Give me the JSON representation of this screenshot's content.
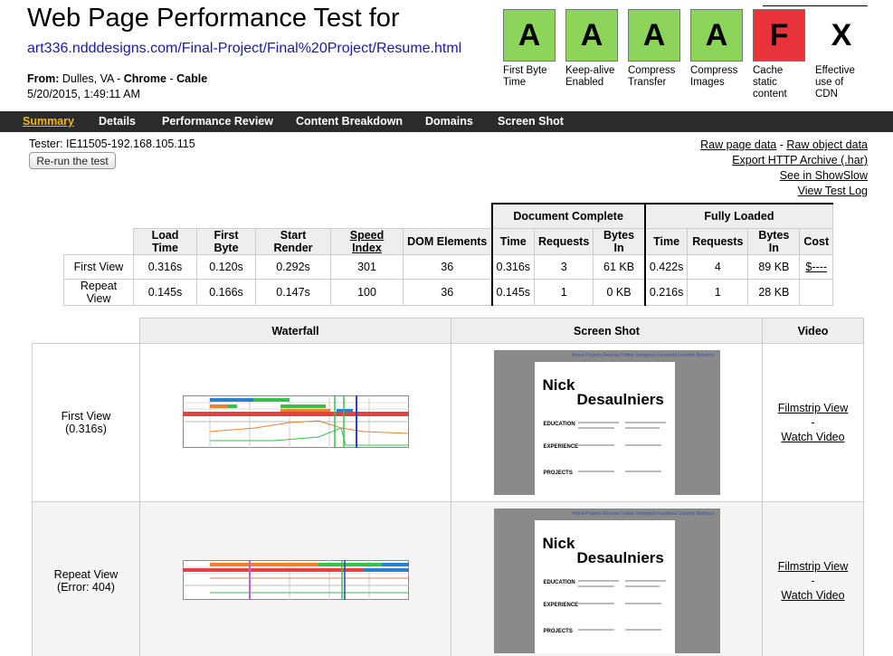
{
  "header": {
    "title": "Web Page Performance Test for",
    "url": "art336.ndddesigns.com/Final-Project/Final%20Project/Resume.html",
    "from_label": "From:",
    "from_location": "Dulles, VA - ",
    "from_browser": "Chrome",
    "from_sep": " - ",
    "from_conn": "Cable",
    "date": "5/20/2015, 1:49:11 AM"
  },
  "grades": [
    {
      "letter": "A",
      "label": "First Byte Time",
      "color": "#8dd45a"
    },
    {
      "letter": "A",
      "label": "Keep-alive Enabled",
      "color": "#8dd45a"
    },
    {
      "letter": "A",
      "label": "Compress Transfer",
      "color": "#8dd45a"
    },
    {
      "letter": "A",
      "label": "Compress Images",
      "color": "#8dd45a"
    },
    {
      "letter": "F",
      "label": "Cache static content",
      "color": "#e8333b"
    },
    {
      "letter": "X",
      "label": "Effective use of CDN",
      "color": "#ffffff"
    }
  ],
  "nav": {
    "summary": "Summary",
    "details": "Details",
    "performance_review": "Performance Review",
    "content_breakdown": "Content Breakdown",
    "domains": "Domains",
    "screen_shot": "Screen Shot"
  },
  "tester": "Tester: IE11505-192.168.105.115",
  "rerun": "Re-run the test",
  "links": {
    "raw_page": "Raw page data",
    "sep": " - ",
    "raw_object": "Raw object data",
    "export_har": "Export HTTP Archive (.har)",
    "showslow": "See in ShowSlow",
    "test_log": "View Test Log"
  },
  "results": {
    "group_doc": "Document Complete",
    "group_full": "Fully Loaded",
    "headers": [
      "Load Time",
      "First Byte",
      "Start Render",
      "Speed Index",
      "DOM Elements",
      "Time",
      "Requests",
      "Bytes In",
      "Time",
      "Requests",
      "Bytes In",
      "Cost"
    ],
    "rows": [
      {
        "label": "First View",
        "cells": [
          "0.316s",
          "0.120s",
          "0.292s",
          "301",
          "36",
          "0.316s",
          "3",
          "61 KB",
          "0.422s",
          "4",
          "89 KB",
          "$----"
        ]
      },
      {
        "label": "Repeat View",
        "cells": [
          "0.145s",
          "0.166s",
          "0.147s",
          "100",
          "36",
          "0.145s",
          "1",
          "0 KB",
          "0.216s",
          "1",
          "28 KB",
          ""
        ]
      }
    ]
  },
  "visuals": {
    "headers": [
      "Waterfall",
      "Screen Shot",
      "Video"
    ],
    "rows": [
      {
        "label": "First View",
        "sub": "(0.316s)",
        "filmstrip": "Filmstrip View",
        "dash": "-",
        "watch": "Watch Video"
      },
      {
        "label": "Repeat View",
        "sub": "(Error: 404)",
        "filmstrip": "Filmstrip View",
        "dash": "-",
        "watch": "Watch Video"
      }
    ],
    "shot": {
      "nav": "Home Projects Resume Twitter Instagram Facebook LinkedIn Behance",
      "name_first": "Nick",
      "name_last": "Desaulniers",
      "sec_education": "EDUCATION",
      "sec_experience": "EXPERIENCE",
      "sec_projects": "PROJECTS"
    }
  }
}
